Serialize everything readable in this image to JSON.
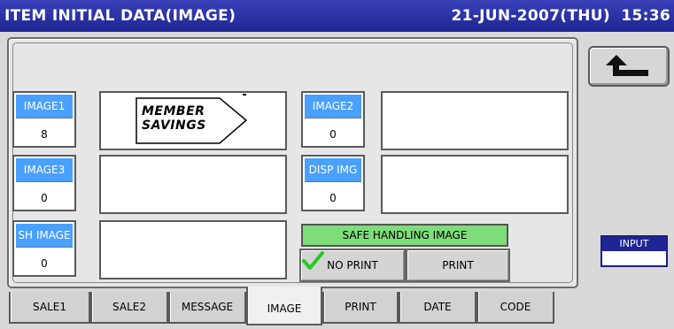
{
  "title": "ITEM INITIAL DATA(IMAGE)",
  "datetime": "21-JUN-2007(THU)  15:36",
  "fields": {
    "image1": {
      "label": "IMAGE1",
      "value": "8"
    },
    "image2": {
      "label": "IMAGE2",
      "value": "0"
    },
    "image3": {
      "label": "IMAGE3",
      "value": "0"
    },
    "disp_img": {
      "label": "DISP IMG",
      "value": "0"
    },
    "sh_image": {
      "label": "SH IMAGE",
      "value": "0"
    }
  },
  "image1_preview": {
    "line1": "MEMBER",
    "line2": "SAVINGS"
  },
  "safe_handling": {
    "title": "SAFE HANDLING IMAGE",
    "no_print": "NO PRINT",
    "print": "PRINT",
    "selected": "no_print"
  },
  "input_indicator": {
    "label": "INPUT"
  },
  "tabs": [
    {
      "label": "SALE1"
    },
    {
      "label": "SALE2"
    },
    {
      "label": "MESSAGE"
    },
    {
      "label": "IMAGE"
    },
    {
      "label": "PRINT"
    },
    {
      "label": "DATE"
    },
    {
      "label": "CODE"
    }
  ],
  "active_tab": "IMAGE",
  "colors": {
    "titlebar": "#1e2592",
    "field_label": "#4aa0ff",
    "safe_handling": "#7fdc7a",
    "check": "#22cc22"
  },
  "icons": {
    "back": "return-arrow-icon",
    "selected": "checkmark-icon"
  }
}
